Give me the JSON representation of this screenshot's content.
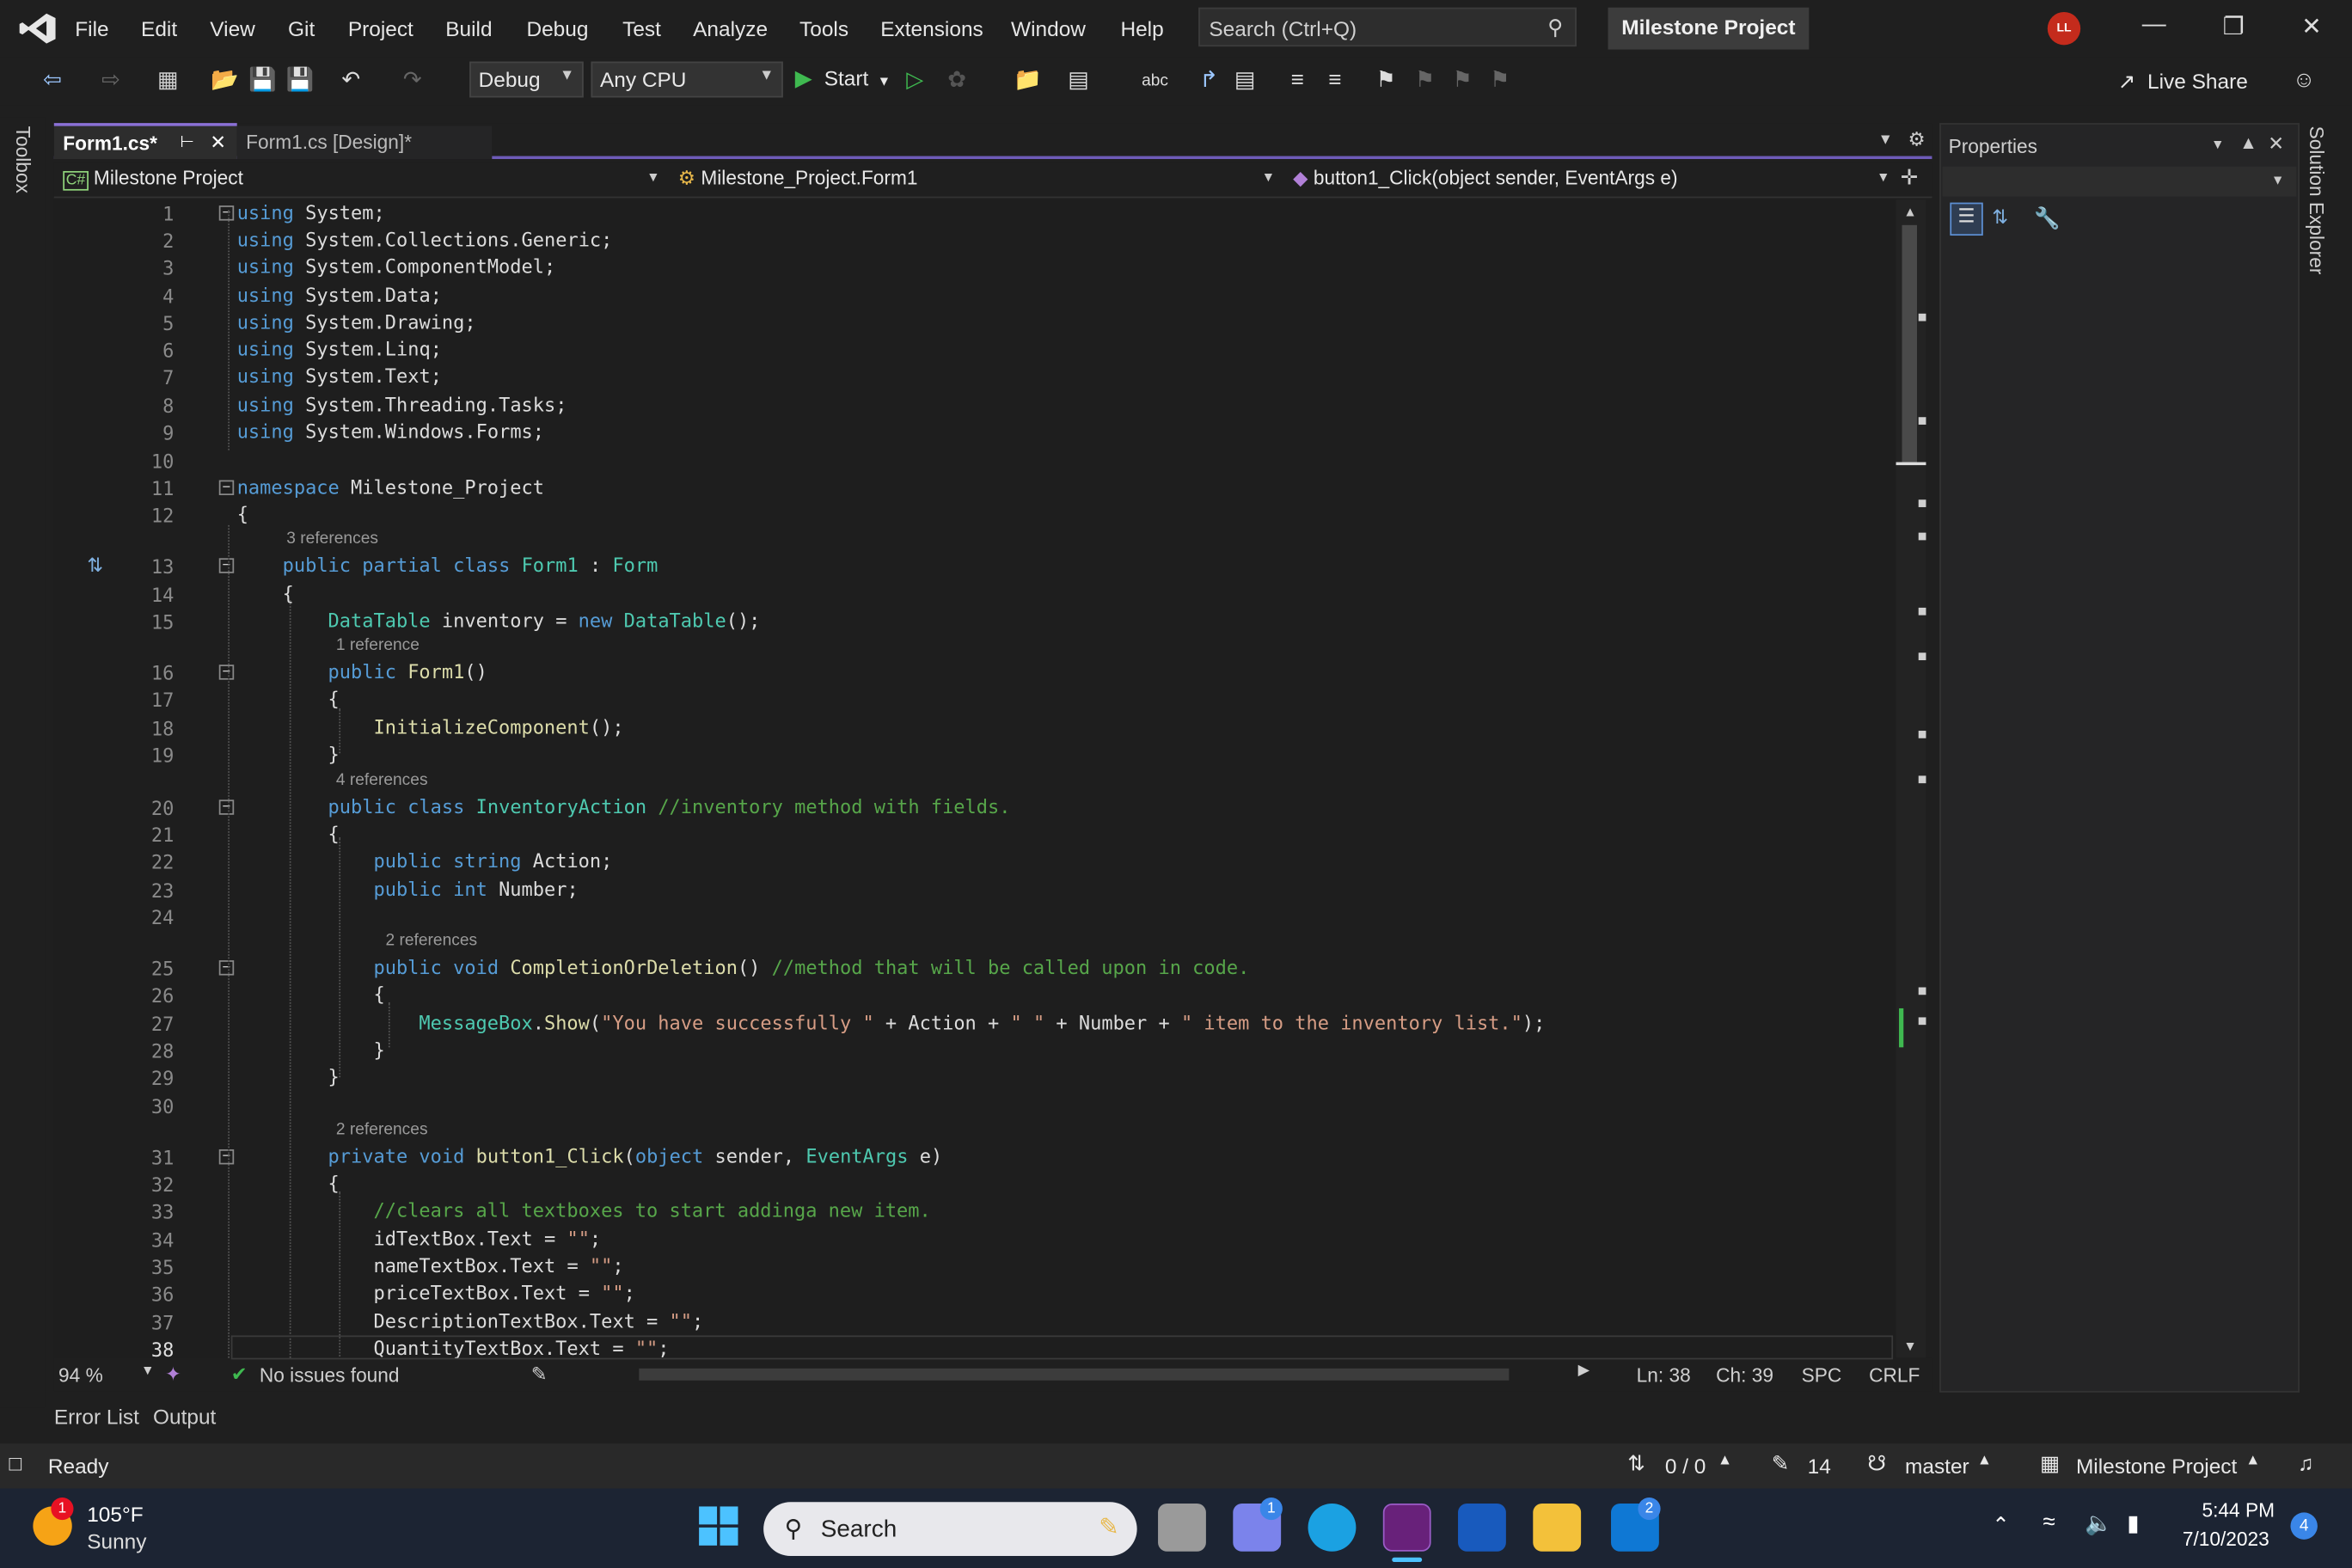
{
  "menubar": {
    "items": [
      "File",
      "Edit",
      "View",
      "Git",
      "Project",
      "Build",
      "Debug",
      "Test",
      "Analyze",
      "Tools",
      "Extensions",
      "Window",
      "Help"
    ],
    "search_placeholder": "Search (Ctrl+Q)",
    "project_title": "Milestone Project",
    "avatar_initials": "LL"
  },
  "toolbar": {
    "config": "Debug",
    "platform": "Any CPU",
    "start_label": "Start",
    "live_share": "Live Share"
  },
  "toolbox_label": "Toolbox",
  "solution_explorer_label": "Solution Explorer",
  "tabs": [
    {
      "label": "Form1.cs*",
      "active": true
    },
    {
      "label": "Form1.cs [Design]*",
      "active": false
    }
  ],
  "navbar": {
    "project": "Milestone Project",
    "class": "Milestone_Project.Form1",
    "member": "button1_Click(object sender, EventArgs e)"
  },
  "code_lines": [
    {
      "n": "1",
      "text": "using System;"
    },
    {
      "n": "2",
      "text": "using System.Collections.Generic;"
    },
    {
      "n": "3",
      "text": "using System.ComponentModel;"
    },
    {
      "n": "4",
      "text": "using System.Data;"
    },
    {
      "n": "5",
      "text": "using System.Drawing;"
    },
    {
      "n": "6",
      "text": "using System.Linq;"
    },
    {
      "n": "7",
      "text": "using System.Text;"
    },
    {
      "n": "8",
      "text": "using System.Threading.Tasks;"
    },
    {
      "n": "9",
      "text": "using System.Windows.Forms;"
    },
    {
      "n": "10",
      "text": ""
    },
    {
      "n": "11",
      "text": "namespace Milestone_Project"
    },
    {
      "n": "12",
      "text": "{"
    },
    {
      "n": "13",
      "text": "    public partial class Form1 : Form"
    },
    {
      "n": "14",
      "text": "    {"
    },
    {
      "n": "15",
      "text": "        DataTable inventory = new DataTable();"
    },
    {
      "n": "16",
      "text": "        public Form1()"
    },
    {
      "n": "17",
      "text": "        {"
    },
    {
      "n": "18",
      "text": "            InitializeComponent();"
    },
    {
      "n": "19",
      "text": "        }"
    },
    {
      "n": "20",
      "text": "        public class InventoryAction //inventory method with fields."
    },
    {
      "n": "21",
      "text": "        {"
    },
    {
      "n": "22",
      "text": "            public string Action;"
    },
    {
      "n": "23",
      "text": "            public int Number;"
    },
    {
      "n": "24",
      "text": ""
    },
    {
      "n": "25",
      "text": "            public void CompletionOrDeletion() //method that will be called upon in code."
    },
    {
      "n": "26",
      "text": "            {"
    },
    {
      "n": "27",
      "text": "                MessageBox.Show(\"You have successfully \" + Action + \" \" + Number + \" item to the inventory list.\");"
    },
    {
      "n": "28",
      "text": "            }"
    },
    {
      "n": "29",
      "text": "        }"
    },
    {
      "n": "30",
      "text": ""
    },
    {
      "n": "31",
      "text": "        private void button1_Click(object sender, EventArgs e)"
    },
    {
      "n": "32",
      "text": "        {"
    },
    {
      "n": "33",
      "text": "            //clears all textboxes to start addinga new item."
    },
    {
      "n": "34",
      "text": "            idTextBox.Text = \"\";"
    },
    {
      "n": "35",
      "text": "            nameTextBox.Text = \"\";"
    },
    {
      "n": "36",
      "text": "            priceTextBox.Text = \"\";"
    },
    {
      "n": "37",
      "text": "            DescriptionTextBox.Text = \"\";"
    },
    {
      "n": "38",
      "text": "            QuantityTextBox.Text = \"\";"
    }
  ],
  "references": [
    "3 references",
    "1 reference",
    "4 references",
    "2 references",
    "2 references"
  ],
  "editor_status": {
    "zoom": "94 %",
    "issues": "No issues found",
    "line": "Ln: 38",
    "col": "Ch: 39",
    "spc": "SPC",
    "eol": "CRLF"
  },
  "properties": {
    "title": "Properties"
  },
  "bottom_tabs": [
    "Error List",
    "Output"
  ],
  "statusbar": {
    "ready": "Ready",
    "changes": "0 / 0",
    "edits": "14",
    "branch": "master",
    "project": "Milestone Project"
  },
  "taskbar": {
    "weather_temp": "105°F",
    "weather_desc": "Sunny",
    "weather_badge": "1",
    "search": "Search",
    "teams_badge": "1",
    "mail_badge": "2",
    "time": "5:44 PM",
    "date": "7/10/2023",
    "notif_count": "4"
  }
}
